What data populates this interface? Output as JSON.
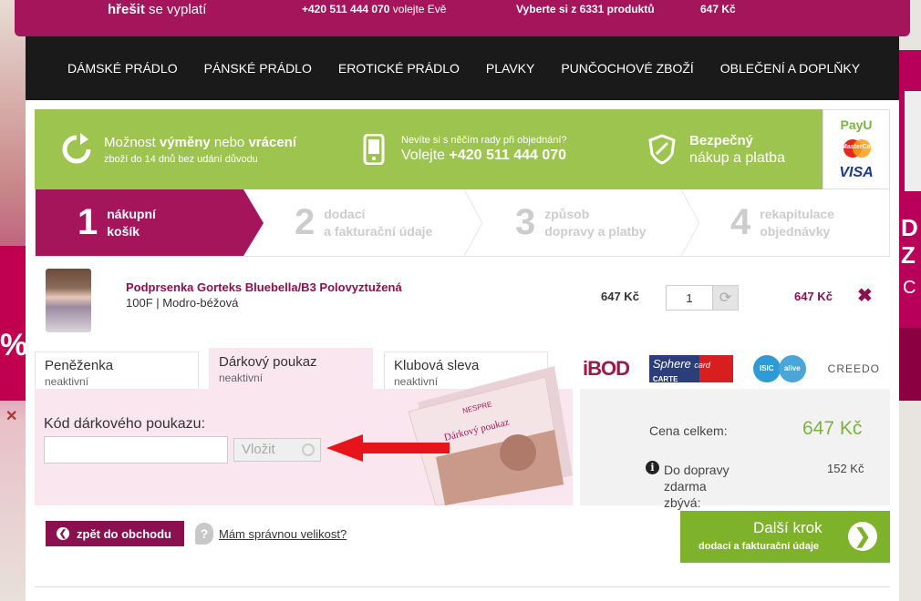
{
  "topbar": {
    "slogan_bold": "hřešit",
    "slogan_rest": "se vyplatí",
    "phone": "+420 511 444 070",
    "phone_note": "volejte Evě",
    "products": "Vyberte si z 6331 produktů",
    "cart_total": "647  Kč"
  },
  "nav": [
    "DÁMSKÉ PRÁDLO",
    "PÁNSKÉ PRÁDLO",
    "EROTICKÉ PRÁDLO",
    "PLAVKY",
    "PUNČOCHOVÉ ZBOŽÍ",
    "OBLEČENÍ A DOPLŇKY"
  ],
  "benefits": {
    "return_a": "Možnost ",
    "return_b": "výměny",
    "return_c": " nebo ",
    "return_d": "vrácení",
    "return_sub": "zboží do 14 dnů bez udání důvodu",
    "advice_line": "Nevíte si s něčím rady při objednání?",
    "advice_call": "Volejte",
    "advice_phone": "+420 511 444 070",
    "secure_title": "Bezpečný",
    "secure_sub": "nákup a platba",
    "payu": "PayU",
    "mastercard": "MasterCard",
    "visa": "VISA"
  },
  "steps": [
    {
      "num": "1",
      "l1": "nákupní",
      "l2": "košík"
    },
    {
      "num": "2",
      "l1": "dodací",
      "l2": "a fakturační údaje"
    },
    {
      "num": "3",
      "l1": "způsob",
      "l2": "dopravy a platby"
    },
    {
      "num": "4",
      "l1": "rekapitulace",
      "l2": "objednávky"
    }
  ],
  "cart_item": {
    "name": "Podprsenka Gorteks Bluebella/B3 Polovyztužená",
    "variant": "100F | Modro-béžová",
    "unit_price": "647 Kč",
    "quantity": "1",
    "total": "647 Kč"
  },
  "tabs": [
    {
      "title": "Peněženka",
      "status": "neaktivní"
    },
    {
      "title": "Dárkový poukaz",
      "status": "neaktivní"
    },
    {
      "title": "Klubová sleva",
      "status": "neaktivní"
    }
  ],
  "voucher": {
    "label": "Kód dárkového poukazu:",
    "input_value": "",
    "button": "Vložit",
    "card_brand": "NESPRE",
    "card_text": "Dárkový poukaz"
  },
  "sponsors": {
    "ibod": "iBOD",
    "sphere_1": "Sphere",
    "sphere_2": "card",
    "sphere_3": "CARTE",
    "isic_1": "ISIC",
    "isic_2": "alive",
    "creedo": "CREEDO"
  },
  "summary": {
    "total_label": "Cena celkem:",
    "total_value": "647 Kč",
    "free_label": "Do dopravy zdarma zbývá:",
    "free_value": "152 Kč"
  },
  "actions": {
    "back": "zpět do obchodu",
    "size_help": "Mám správnou velikost?",
    "next_title": "Další krok",
    "next_sub": "dodací a fakturační údaje"
  },
  "side": {
    "left_big": "%",
    "right_big": "D\nZ",
    "right_sm": "C"
  },
  "colors": {
    "brand": "#a5155c",
    "green": "#9dc44f",
    "next_green": "#7fb22b",
    "nav_bg": "#1a1a1a"
  }
}
